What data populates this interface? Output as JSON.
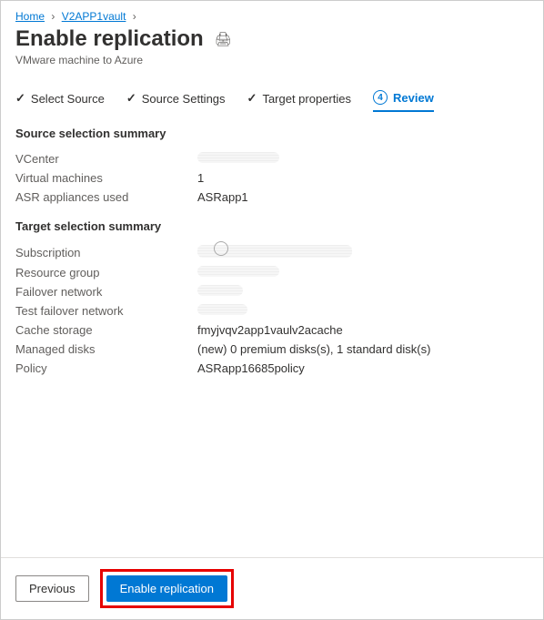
{
  "breadcrumb": {
    "home": "Home",
    "vault": "V2APP1vault"
  },
  "header": {
    "title": "Enable replication",
    "subtitle": "VMware machine to Azure"
  },
  "tabs": {
    "t1": "Select Source",
    "t2": "Source Settings",
    "t3": "Target properties",
    "t4_num": "4",
    "t4": "Review"
  },
  "source_summary": {
    "title": "Source selection summary",
    "rows": {
      "vcenter_label": "VCenter",
      "vcenter_value": "",
      "vm_label": "Virtual machines",
      "vm_value": "1",
      "appliance_label": "ASR appliances used",
      "appliance_value": "ASRapp1"
    }
  },
  "target_summary": {
    "title": "Target selection summary",
    "rows": {
      "sub_label": "Subscription",
      "rg_label": "Resource group",
      "failover_label": "Failover network",
      "testfailover_label": "Test failover network",
      "cache_label": "Cache storage",
      "cache_value": "fmyjvqv2app1vaulv2acache",
      "disks_label": "Managed disks",
      "disks_value": "(new) 0 premium disks(s), 1 standard disk(s)",
      "policy_label": "Policy",
      "policy_value": "ASRapp16685policy"
    }
  },
  "footer": {
    "previous": "Previous",
    "enable": "Enable replication"
  }
}
